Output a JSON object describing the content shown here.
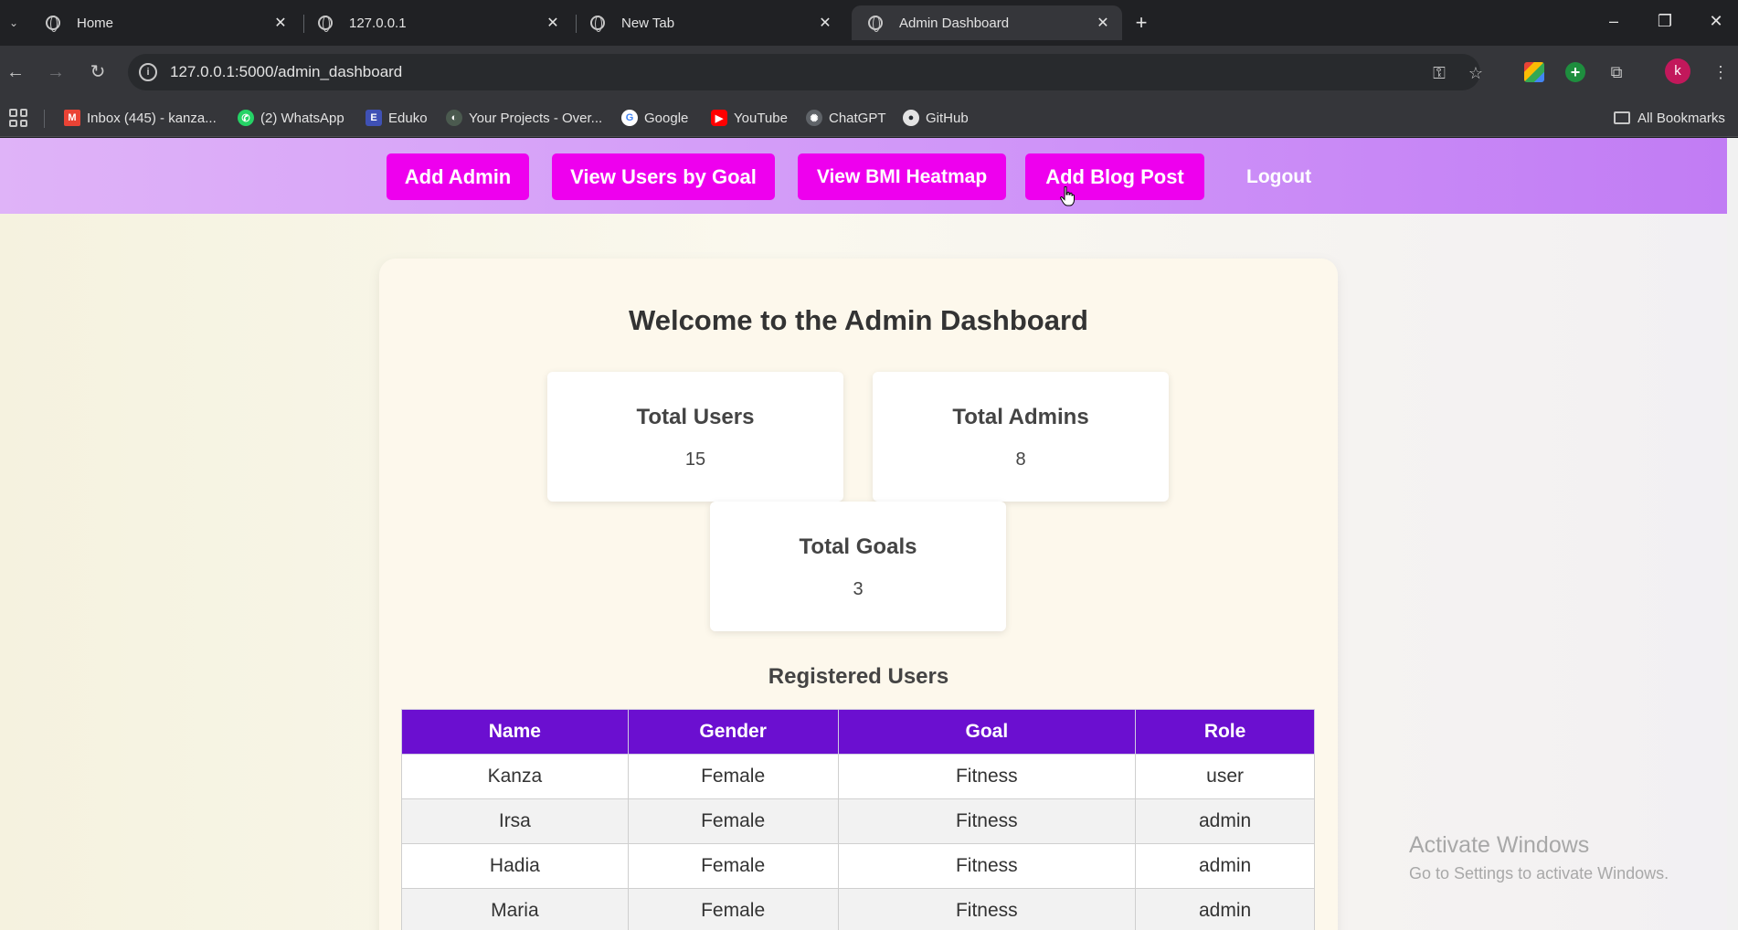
{
  "browser": {
    "tabs": [
      {
        "title": "Home",
        "active": false
      },
      {
        "title": "127.0.0.1",
        "active": false
      },
      {
        "title": "New Tab",
        "active": false
      },
      {
        "title": "Admin Dashboard",
        "active": true
      }
    ],
    "url": "127.0.0.1:5000/admin_dashboard",
    "bookmarks": [
      {
        "label": "Inbox (445) - kanza...",
        "icon": "gmail-icon"
      },
      {
        "label": "(2) WhatsApp",
        "icon": "whatsapp-icon"
      },
      {
        "label": "Eduko",
        "icon": "eduko-icon"
      },
      {
        "label": "Your Projects - Over...",
        "icon": "overleaf-icon"
      },
      {
        "label": "Google",
        "icon": "google-icon"
      },
      {
        "label": "YouTube",
        "icon": "youtube-icon"
      },
      {
        "label": "ChatGPT",
        "icon": "chatgpt-icon"
      },
      {
        "label": "GitHub",
        "icon": "github-icon"
      }
    ],
    "all_bookmarks": "All Bookmarks",
    "profile_initial": "k"
  },
  "nav": {
    "add_admin": "Add Admin",
    "view_users_by_goal": "View Users by Goal",
    "view_bmi_heatmap": "View BMI Heatmap",
    "add_blog_post": "Add Blog Post",
    "logout": "Logout"
  },
  "dashboard": {
    "title": "Welcome to the Admin Dashboard",
    "stats": [
      {
        "label": "Total Users",
        "value": "15"
      },
      {
        "label": "Total Admins",
        "value": "8"
      },
      {
        "label": "Total Goals",
        "value": "3"
      }
    ],
    "users_heading": "Registered Users",
    "table": {
      "headers": [
        "Name",
        "Gender",
        "Goal",
        "Role"
      ],
      "rows": [
        [
          "Kanza",
          "Female",
          "Fitness",
          "user"
        ],
        [
          "Irsa",
          "Female",
          "Fitness",
          "admin"
        ],
        [
          "Hadia",
          "Female",
          "Fitness",
          "admin"
        ],
        [
          "Maria",
          "Female",
          "Fitness",
          "admin"
        ]
      ]
    }
  },
  "watermark": {
    "line1": "Activate Windows",
    "line2": "Go to Settings to activate Windows."
  },
  "colors": {
    "nav_button": "#ee00ee",
    "table_header": "#6b0fd0"
  }
}
